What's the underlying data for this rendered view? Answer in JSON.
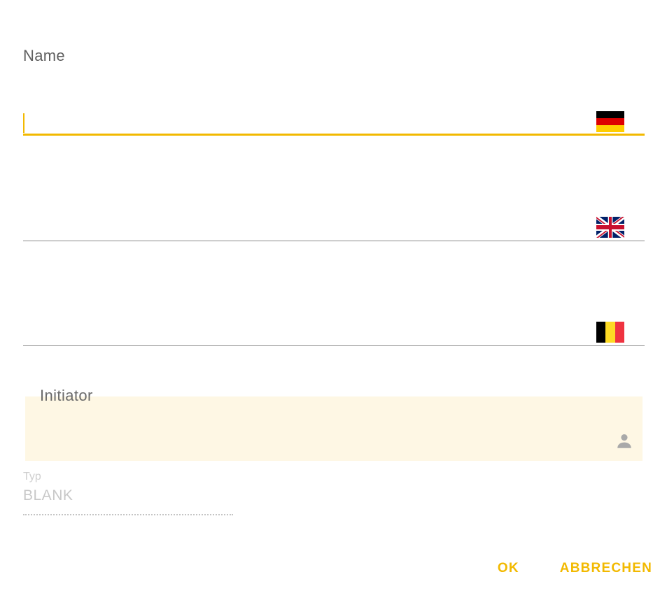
{
  "form": {
    "name_label": "Name",
    "name_fields": [
      {
        "lang": "de",
        "value": "",
        "flag_icon": "flag-germany-icon"
      },
      {
        "lang": "en",
        "value": "",
        "flag_icon": "flag-uk-icon"
      },
      {
        "lang": "be",
        "value": "",
        "flag_icon": "flag-belgium-icon"
      }
    ],
    "initiator_label": "Initiator",
    "initiator_value": "",
    "initiator_icon": "person-icon",
    "typ_label": "Typ",
    "typ_value": "BLANK"
  },
  "actions": {
    "ok_label": "OK",
    "cancel_label": "ABBRECHEN"
  },
  "colors": {
    "accent": "#f2b900",
    "initiator_bg": "#fef7e4",
    "underline": "#8a8a8a"
  }
}
